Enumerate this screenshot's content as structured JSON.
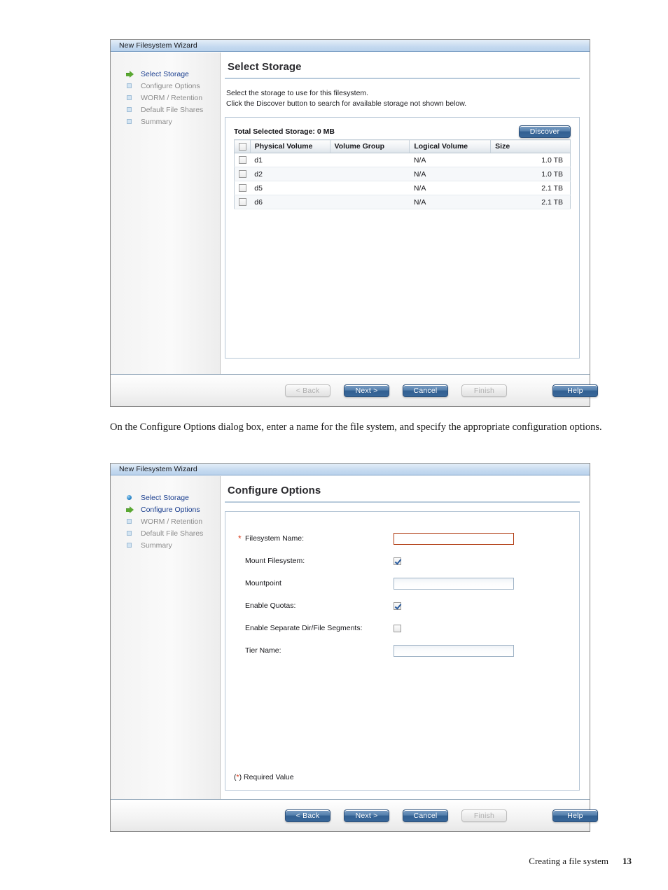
{
  "document": {
    "paragraph": "On the Configure Options dialog box, enter a name for the file system, and specify the appropriate configuration options.",
    "footer_text": "Creating a file system",
    "page_number": "13"
  },
  "colors": {
    "accent_blue": "#1b3f8f",
    "button_blue": "#315f92",
    "required_red": "#b03a10",
    "step_green": "#5aa832",
    "titlebar_blue": "#c5daf0"
  },
  "wizard1": {
    "title": "New Filesystem Wizard",
    "steps": [
      {
        "label": "Select Storage",
        "icon": "green-arrow-icon",
        "state": "active"
      },
      {
        "label": "Configure Options",
        "icon": "square-icon",
        "state": "pending"
      },
      {
        "label": "WORM / Retention",
        "icon": "square-icon",
        "state": "pending"
      },
      {
        "label": "Default File Shares",
        "icon": "square-icon",
        "state": "pending"
      },
      {
        "label": "Summary",
        "icon": "square-icon",
        "state": "pending"
      }
    ],
    "heading": "Select Storage",
    "intro_line1": "Select the storage to use for this filesystem.",
    "intro_line2": "Click the Discover button to search for available storage not shown below.",
    "total_storage": "Total Selected Storage: 0 MB",
    "discover_label": "Discover",
    "table": {
      "headers": [
        "Physical Volume",
        "Volume Group",
        "Logical Volume",
        "Size"
      ],
      "rows": [
        {
          "physical_volume": "d1",
          "volume_group": "",
          "logical_volume": "N/A",
          "size": "1.0 TB"
        },
        {
          "physical_volume": "d2",
          "volume_group": "",
          "logical_volume": "N/A",
          "size": "1.0 TB"
        },
        {
          "physical_volume": "d5",
          "volume_group": "",
          "logical_volume": "N/A",
          "size": "2.1 TB"
        },
        {
          "physical_volume": "d6",
          "volume_group": "",
          "logical_volume": "N/A",
          "size": "2.1 TB"
        }
      ]
    },
    "buttons": {
      "back": "< Back",
      "next": "Next >",
      "cancel": "Cancel",
      "finish": "Finish",
      "help": "Help"
    }
  },
  "wizard2": {
    "title": "New Filesystem Wizard",
    "steps": [
      {
        "label": "Select Storage",
        "icon": "blue-dot-icon",
        "state": "done"
      },
      {
        "label": "Configure Options",
        "icon": "green-arrow-icon",
        "state": "active"
      },
      {
        "label": "WORM / Retention",
        "icon": "square-icon",
        "state": "pending"
      },
      {
        "label": "Default File Shares",
        "icon": "square-icon",
        "state": "pending"
      },
      {
        "label": "Summary",
        "icon": "square-icon",
        "state": "pending"
      }
    ],
    "heading": "Configure Options",
    "fields": [
      {
        "label": "Filesystem Name:",
        "type": "text",
        "value": "",
        "required": true
      },
      {
        "label": "Mount Filesystem:",
        "type": "checkbox",
        "checked": true,
        "required": false
      },
      {
        "label": "Mountpoint",
        "type": "text",
        "value": "",
        "required": false
      },
      {
        "label": "Enable Quotas:",
        "type": "checkbox",
        "checked": true,
        "required": false
      },
      {
        "label": "Enable Separate Dir/File Segments:",
        "type": "checkbox",
        "checked": false,
        "required": false
      },
      {
        "label": "Tier Name:",
        "type": "text",
        "value": "",
        "required": false
      }
    ],
    "required_note_open": "(",
    "required_note_star": "*",
    "required_note_rest": ") Required Value",
    "buttons": {
      "back": "< Back",
      "next": "Next >",
      "cancel": "Cancel",
      "finish": "Finish",
      "help": "Help"
    }
  }
}
